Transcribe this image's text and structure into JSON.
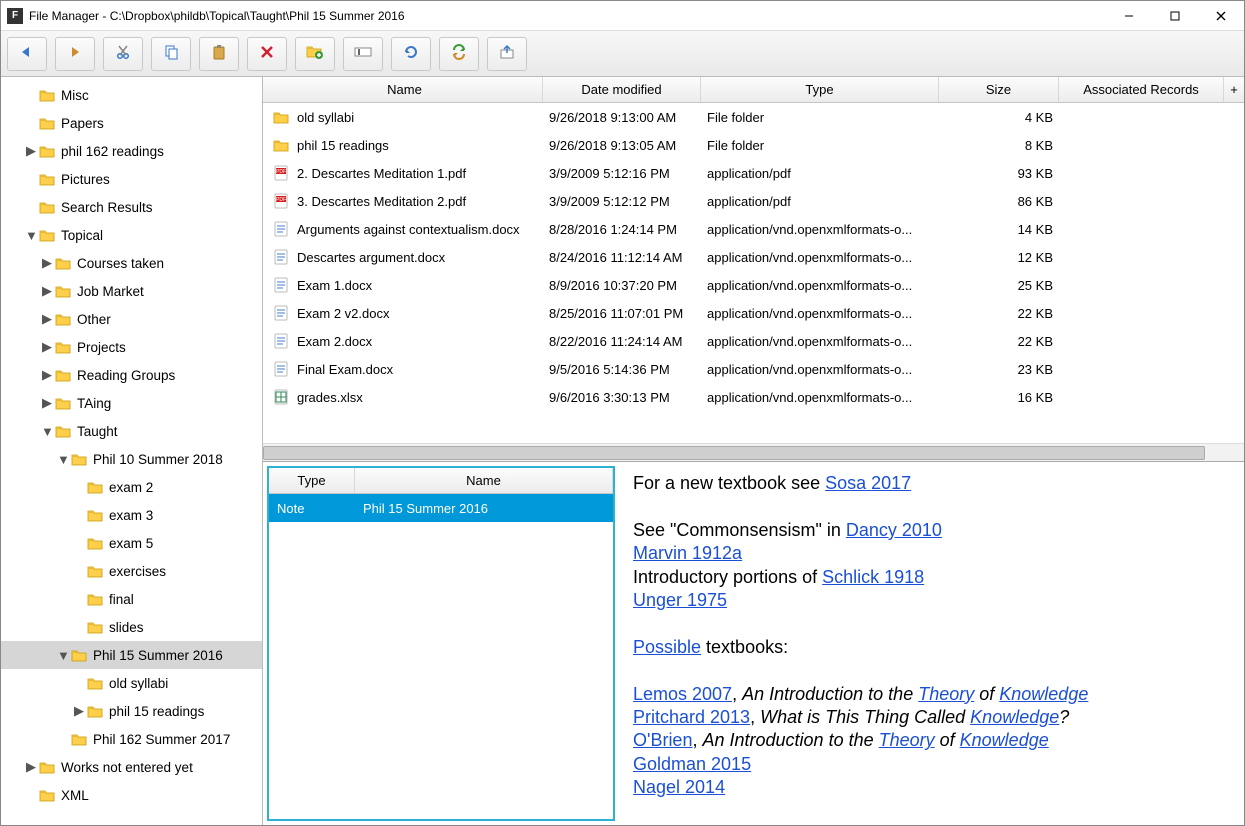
{
  "titlebar": {
    "title": "File Manager - C:\\Dropbox\\phildb\\Topical\\Taught\\Phil 15 Summer 2016"
  },
  "toolbar_icons": [
    "back",
    "forward",
    "cut",
    "copy",
    "paste",
    "delete",
    "new-folder",
    "rename",
    "refresh",
    "sync",
    "export"
  ],
  "tree": [
    {
      "indent": 1,
      "tw": "",
      "label": "Misc"
    },
    {
      "indent": 1,
      "tw": "",
      "label": "Papers"
    },
    {
      "indent": 1,
      "tw": "▶",
      "label": "phil 162 readings"
    },
    {
      "indent": 1,
      "tw": "",
      "label": "Pictures"
    },
    {
      "indent": 1,
      "tw": "",
      "label": "Search Results"
    },
    {
      "indent": 1,
      "tw": "▼",
      "label": "Topical"
    },
    {
      "indent": 2,
      "tw": "▶",
      "label": "Courses taken"
    },
    {
      "indent": 2,
      "tw": "▶",
      "label": "Job Market"
    },
    {
      "indent": 2,
      "tw": "▶",
      "label": "Other"
    },
    {
      "indent": 2,
      "tw": "▶",
      "label": "Projects"
    },
    {
      "indent": 2,
      "tw": "▶",
      "label": "Reading Groups"
    },
    {
      "indent": 2,
      "tw": "▶",
      "label": "TAing"
    },
    {
      "indent": 2,
      "tw": "▼",
      "label": "Taught"
    },
    {
      "indent": 3,
      "tw": "▼",
      "label": "Phil 10 Summer 2018"
    },
    {
      "indent": 4,
      "tw": "",
      "label": "exam 2"
    },
    {
      "indent": 4,
      "tw": "",
      "label": "exam 3"
    },
    {
      "indent": 4,
      "tw": "",
      "label": "exam 5"
    },
    {
      "indent": 4,
      "tw": "",
      "label": "exercises"
    },
    {
      "indent": 4,
      "tw": "",
      "label": "final"
    },
    {
      "indent": 4,
      "tw": "",
      "label": "slides"
    },
    {
      "indent": 3,
      "tw": "▼",
      "label": "Phil 15 Summer 2016",
      "selected": true
    },
    {
      "indent": 4,
      "tw": "",
      "label": "old syllabi"
    },
    {
      "indent": 4,
      "tw": "▶",
      "label": "phil 15 readings"
    },
    {
      "indent": 3,
      "tw": "",
      "label": "Phil 162 Summer 2017"
    },
    {
      "indent": 1,
      "tw": "▶",
      "label": "Works not entered yet"
    },
    {
      "indent": 1,
      "tw": "",
      "label": "XML"
    }
  ],
  "grid": {
    "columns": {
      "name": "Name",
      "date": "Date modified",
      "type": "Type",
      "size": "Size",
      "assoc": "Associated Records"
    },
    "rows": [
      {
        "icon": "folder",
        "name": "old syllabi",
        "date": "9/26/2018 9:13:00 AM",
        "type": "File folder",
        "size": "4 KB"
      },
      {
        "icon": "folder",
        "name": "phil 15 readings",
        "date": "9/26/2018 9:13:05 AM",
        "type": "File folder",
        "size": "8 KB"
      },
      {
        "icon": "pdf",
        "name": "2. Descartes Meditation 1.pdf",
        "date": "3/9/2009 5:12:16 PM",
        "type": "application/pdf",
        "size": "93 KB"
      },
      {
        "icon": "pdf",
        "name": "3. Descartes Meditation 2.pdf",
        "date": "3/9/2009 5:12:12 PM",
        "type": "application/pdf",
        "size": "86 KB"
      },
      {
        "icon": "docx",
        "name": "Arguments against contextualism.docx",
        "date": "8/28/2016 1:24:14 PM",
        "type": "application/vnd.openxmlformats-o...",
        "size": "14 KB"
      },
      {
        "icon": "docx",
        "name": "Descartes argument.docx",
        "date": "8/24/2016 11:12:14 AM",
        "type": "application/vnd.openxmlformats-o...",
        "size": "12 KB"
      },
      {
        "icon": "docx",
        "name": "Exam 1.docx",
        "date": "8/9/2016 10:37:20 PM",
        "type": "application/vnd.openxmlformats-o...",
        "size": "25 KB"
      },
      {
        "icon": "docx",
        "name": "Exam 2 v2.docx",
        "date": "8/25/2016 11:07:01 PM",
        "type": "application/vnd.openxmlformats-o...",
        "size": "22 KB"
      },
      {
        "icon": "docx",
        "name": "Exam 2.docx",
        "date": "8/22/2016 11:24:14 AM",
        "type": "application/vnd.openxmlformats-o...",
        "size": "22 KB"
      },
      {
        "icon": "docx",
        "name": "Final Exam.docx",
        "date": "9/5/2016 5:14:36 PM",
        "type": "application/vnd.openxmlformats-o...",
        "size": "23 KB"
      },
      {
        "icon": "xlsx",
        "name": "grades.xlsx",
        "date": "9/6/2016 3:30:13 PM",
        "type": "application/vnd.openxmlformats-o...",
        "size": "16 KB"
      }
    ]
  },
  "records": {
    "columns": {
      "type": "Type",
      "name": "Name"
    },
    "rows": [
      {
        "type": "Note",
        "name": "Phil 15 Summer 2016",
        "selected": true
      }
    ]
  },
  "preview": {
    "lines": [
      [
        {
          "t": "For a new textbook see "
        },
        {
          "t": "Sosa 2017",
          "link": true
        }
      ],
      [],
      [
        {
          "t": "See \"Commonsensism\" in "
        },
        {
          "t": "Dancy 2010",
          "link": true
        }
      ],
      [
        {
          "t": "Marvin 1912a",
          "link": true
        }
      ],
      [
        {
          "t": "Introductory portions of "
        },
        {
          "t": "Schlick 1918",
          "link": true
        }
      ],
      [
        {
          "t": "Unger 1975",
          "link": true
        }
      ],
      [],
      [
        {
          "t": "Possible",
          "link": true
        },
        {
          "t": " textbooks:"
        }
      ],
      [],
      [
        {
          "t": "Lemos 2007",
          "link": true
        },
        {
          "t": ", "
        },
        {
          "t": "An Introduction to the ",
          "em": true
        },
        {
          "t": "Theory",
          "link": true,
          "em": true
        },
        {
          "t": " of ",
          "em": true
        },
        {
          "t": "Knowledge",
          "link": true,
          "em": true
        }
      ],
      [
        {
          "t": "Pritchard 2013",
          "link": true
        },
        {
          "t": ", "
        },
        {
          "t": "What is This Thing Called ",
          "em": true
        },
        {
          "t": "Knowledge",
          "link": true,
          "em": true
        },
        {
          "t": "?",
          "em": true
        }
      ],
      [
        {
          "t": "O'Brien",
          "link": true
        },
        {
          "t": ", "
        },
        {
          "t": "An Introduction to the ",
          "em": true
        },
        {
          "t": "Theory",
          "link": true,
          "em": true
        },
        {
          "t": " of ",
          "em": true
        },
        {
          "t": "Knowledge",
          "link": true,
          "em": true
        }
      ],
      [
        {
          "t": "Goldman 2015",
          "link": true
        }
      ],
      [
        {
          "t": "Nagel 2014",
          "link": true
        }
      ]
    ]
  }
}
